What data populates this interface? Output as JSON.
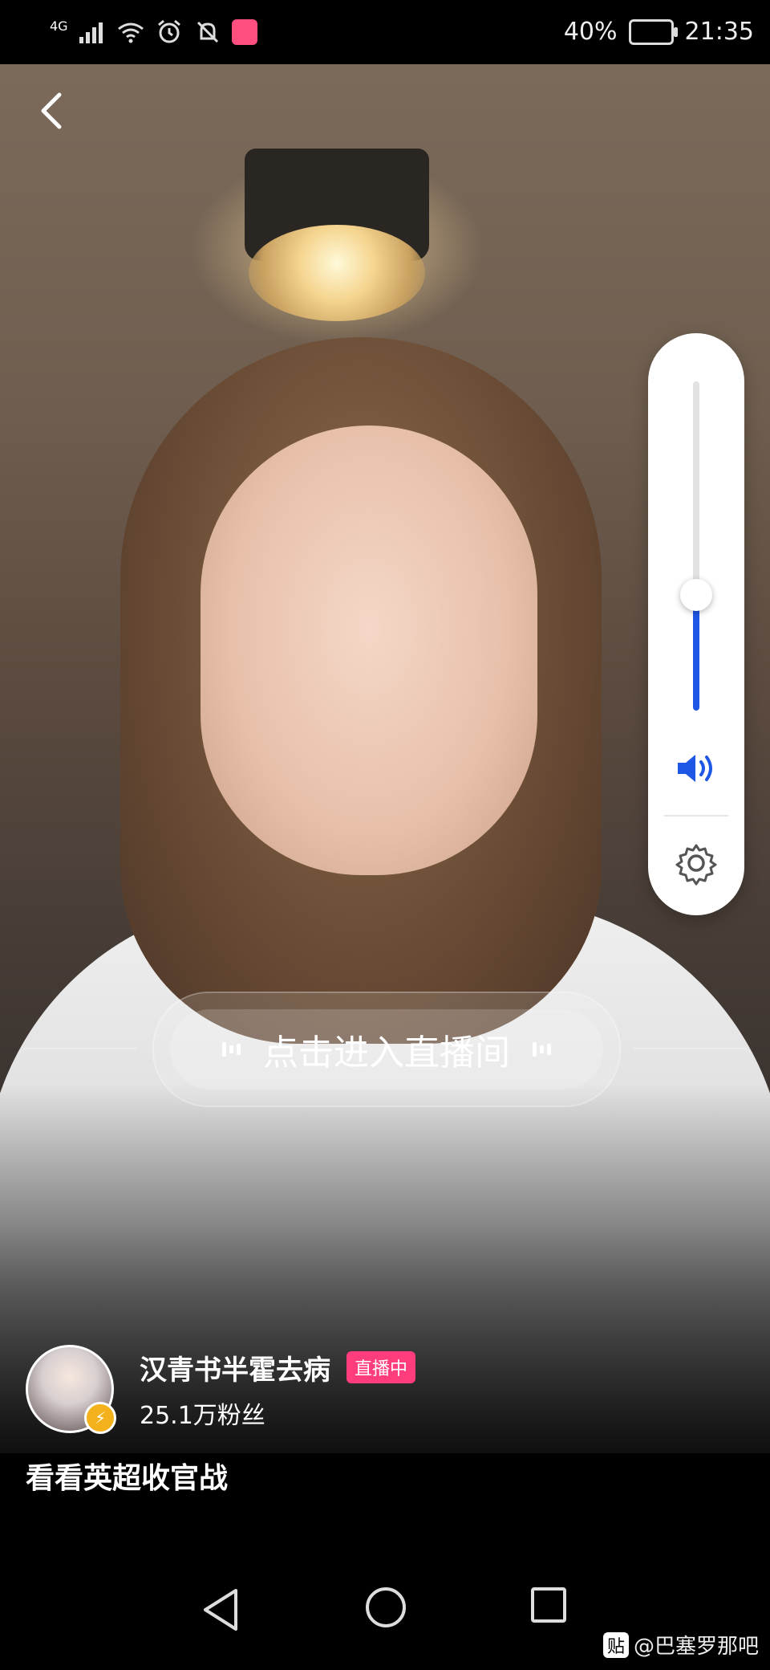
{
  "status_bar": {
    "network": "4G",
    "battery_percent": "40%",
    "time": "21:35"
  },
  "player": {
    "volume_level": 0.35,
    "accent_color": "#1e57e6"
  },
  "enter_live": {
    "label": "点击进入直播间"
  },
  "streamer": {
    "name": "汉青书半霍去病",
    "live_badge": "直播中",
    "fans": "25.1万粉丝",
    "badge_color": "#ff3d7c"
  },
  "caption": "看看英超收官战",
  "watermark": {
    "text": "@巴塞罗那吧",
    "logo_text": "贴"
  }
}
